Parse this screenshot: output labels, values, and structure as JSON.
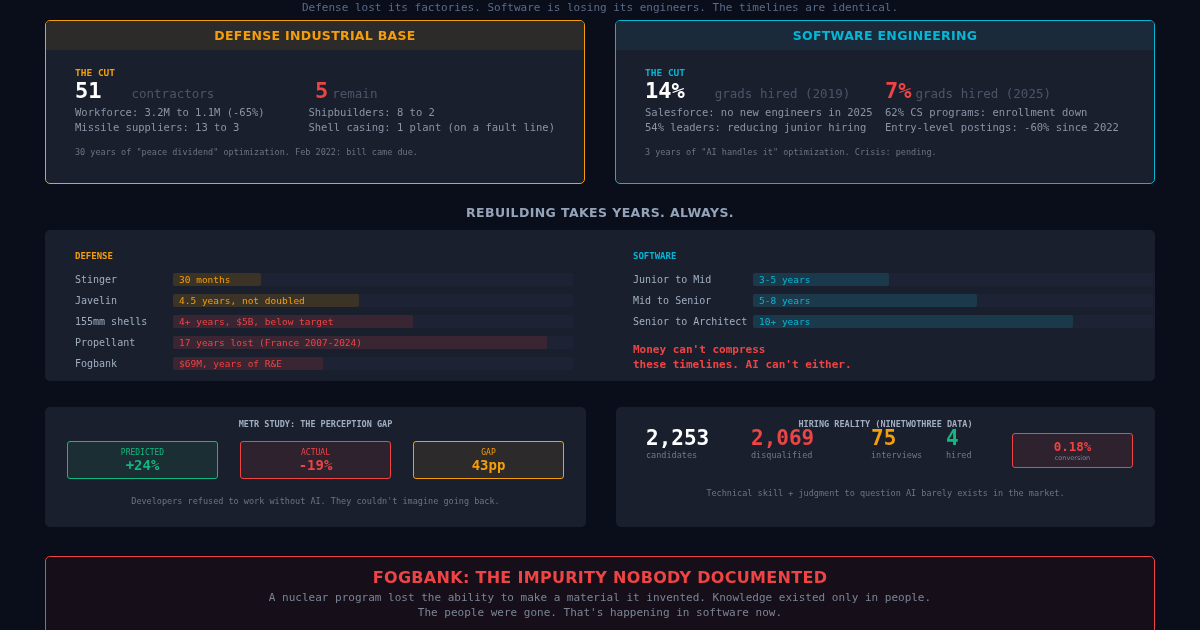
{
  "intro": "Defense lost its factories. Software is losing its engineers. The timelines are identical.",
  "comparison": [
    {
      "title": "DEFENSE INDUSTRIAL BASE",
      "kind": "defense",
      "label": "THE CUT",
      "before_value": "51",
      "before_label": "contractors",
      "after_value": "5",
      "after_label": "remain",
      "facts": [
        "Workforce: 3.2M to 1.1M (-65%)",
        "Shipbuilders: 8 to 2",
        "Missile suppliers: 13 to 3",
        "Shell casing: 1 plant (on a fault line)"
      ],
      "note": "30 years of \"peace dividend\" optimization. Feb 2022: bill came due."
    },
    {
      "title": "SOFTWARE ENGINEERING",
      "kind": "software",
      "label": "THE CUT",
      "before_value": "14%",
      "before_label": "grads hired (2019)",
      "after_value": "7%",
      "after_label": "grads hired (2025)",
      "facts": [
        "Salesforce: no new engineers in 2025",
        "62% CS programs: enrollment down",
        "54% leaders: reducing junior hiring",
        "Entry-level postings: -60% since 2022"
      ],
      "note": "3 years of \"AI handles it\" optimization. Crisis: pending."
    }
  ],
  "rebuild": {
    "heading": "REBUILDING TAKES YEARS. ALWAYS.",
    "columns": [
      {
        "title": "DEFENSE",
        "kind": "defense",
        "rows": [
          {
            "name": "Stinger",
            "duration": "30 months",
            "kind": "warning",
            "level": 0.22
          },
          {
            "name": "Javelin",
            "duration": "4.5 years, not doubled",
            "kind": "warning",
            "level": 0.465
          },
          {
            "name": "155mm shells",
            "duration": "4+ years, $5B, below target",
            "kind": "critical",
            "level": 0.6
          },
          {
            "name": "Propellant",
            "duration": "17 years lost (France 2007-2024)",
            "kind": "critical",
            "level": 0.935
          },
          {
            "name": "Fogbank",
            "duration": "$69M, years of R&E",
            "kind": "critical",
            "level": 0.375
          }
        ]
      },
      {
        "title": "SOFTWARE",
        "kind": "software",
        "rows": [
          {
            "name": "Junior to Mid",
            "duration": "3-5 years",
            "kind": "info",
            "level": 0.34
          },
          {
            "name": "Mid to Senior",
            "duration": "5-8 years",
            "kind": "info",
            "level": 0.56
          },
          {
            "name": "Senior to Architect",
            "duration": "10+ years",
            "kind": "info",
            "level": 0.8
          }
        ],
        "callout": "Money can't compress\nthese timelines. AI can't either."
      }
    ]
  },
  "metr": {
    "title": "METR STUDY: THE PERCEPTION GAP",
    "stats": [
      {
        "label": "PREDICTED",
        "value": "+24%",
        "kind": "positive"
      },
      {
        "label": "ACTUAL",
        "value": "-19%",
        "kind": "negative"
      },
      {
        "label": "GAP",
        "value": "43pp",
        "kind": "gap"
      }
    ],
    "note": "Developers refused to work without AI. They couldn't imagine going back."
  },
  "hiring": {
    "title": "HIRING REALITY (NINETWOTHREE DATA)",
    "stats": [
      {
        "value": "2,253",
        "label": "candidates",
        "kind": "neutral"
      },
      {
        "value": "2,069",
        "label": "disqualified",
        "kind": "negative"
      },
      {
        "value": "75",
        "label": "interviews",
        "kind": "gap"
      },
      {
        "value": "4",
        "label": "hired",
        "kind": "positive"
      }
    ],
    "conversion": {
      "value": "0.18%",
      "label": "conversion"
    },
    "note": "Technical skill + judgment to question AI barely exists in the market."
  },
  "fogbank": {
    "title": "FOGBANK: THE IMPURITY NOBODY DOCUMENTED",
    "text": "A nuclear program lost the ability to make a material it invented. Knowledge existed only in people.\nThe people were gone. That's happening in software now."
  }
}
